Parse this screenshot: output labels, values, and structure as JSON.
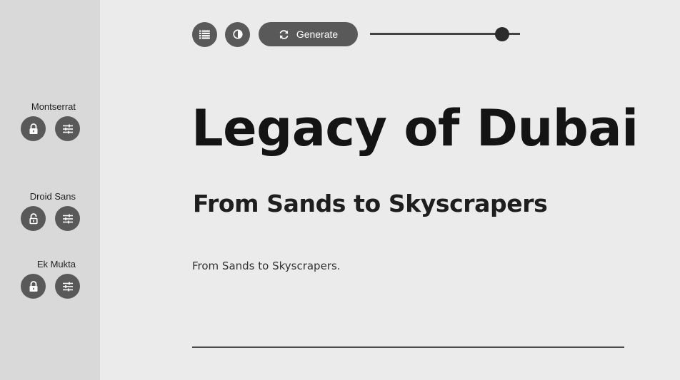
{
  "sidebar": {
    "fonts": [
      {
        "name": "Montserrat",
        "lock_state": "locked"
      },
      {
        "name": "Droid Sans",
        "lock_state": "unlocked"
      },
      {
        "name": "Ek Mukta",
        "lock_state": "locked"
      }
    ]
  },
  "toolbar": {
    "generate_label": "Generate",
    "slider_value": 0.88
  },
  "preview": {
    "headline": "Legacy of Dubai",
    "subheadline": "From Sands to Skyscrapers",
    "body": "From Sands to Skyscrapers."
  },
  "colors": {
    "sidebar_bg": "#d9d9d9",
    "page_bg": "#ebebeb",
    "button_bg": "#595959",
    "text": "#141414"
  },
  "icons": {
    "list": "list-icon",
    "contrast": "contrast-icon",
    "refresh": "refresh-icon",
    "lock": "lock-icon",
    "unlock": "unlock-icon",
    "settings": "sliders-icon"
  }
}
